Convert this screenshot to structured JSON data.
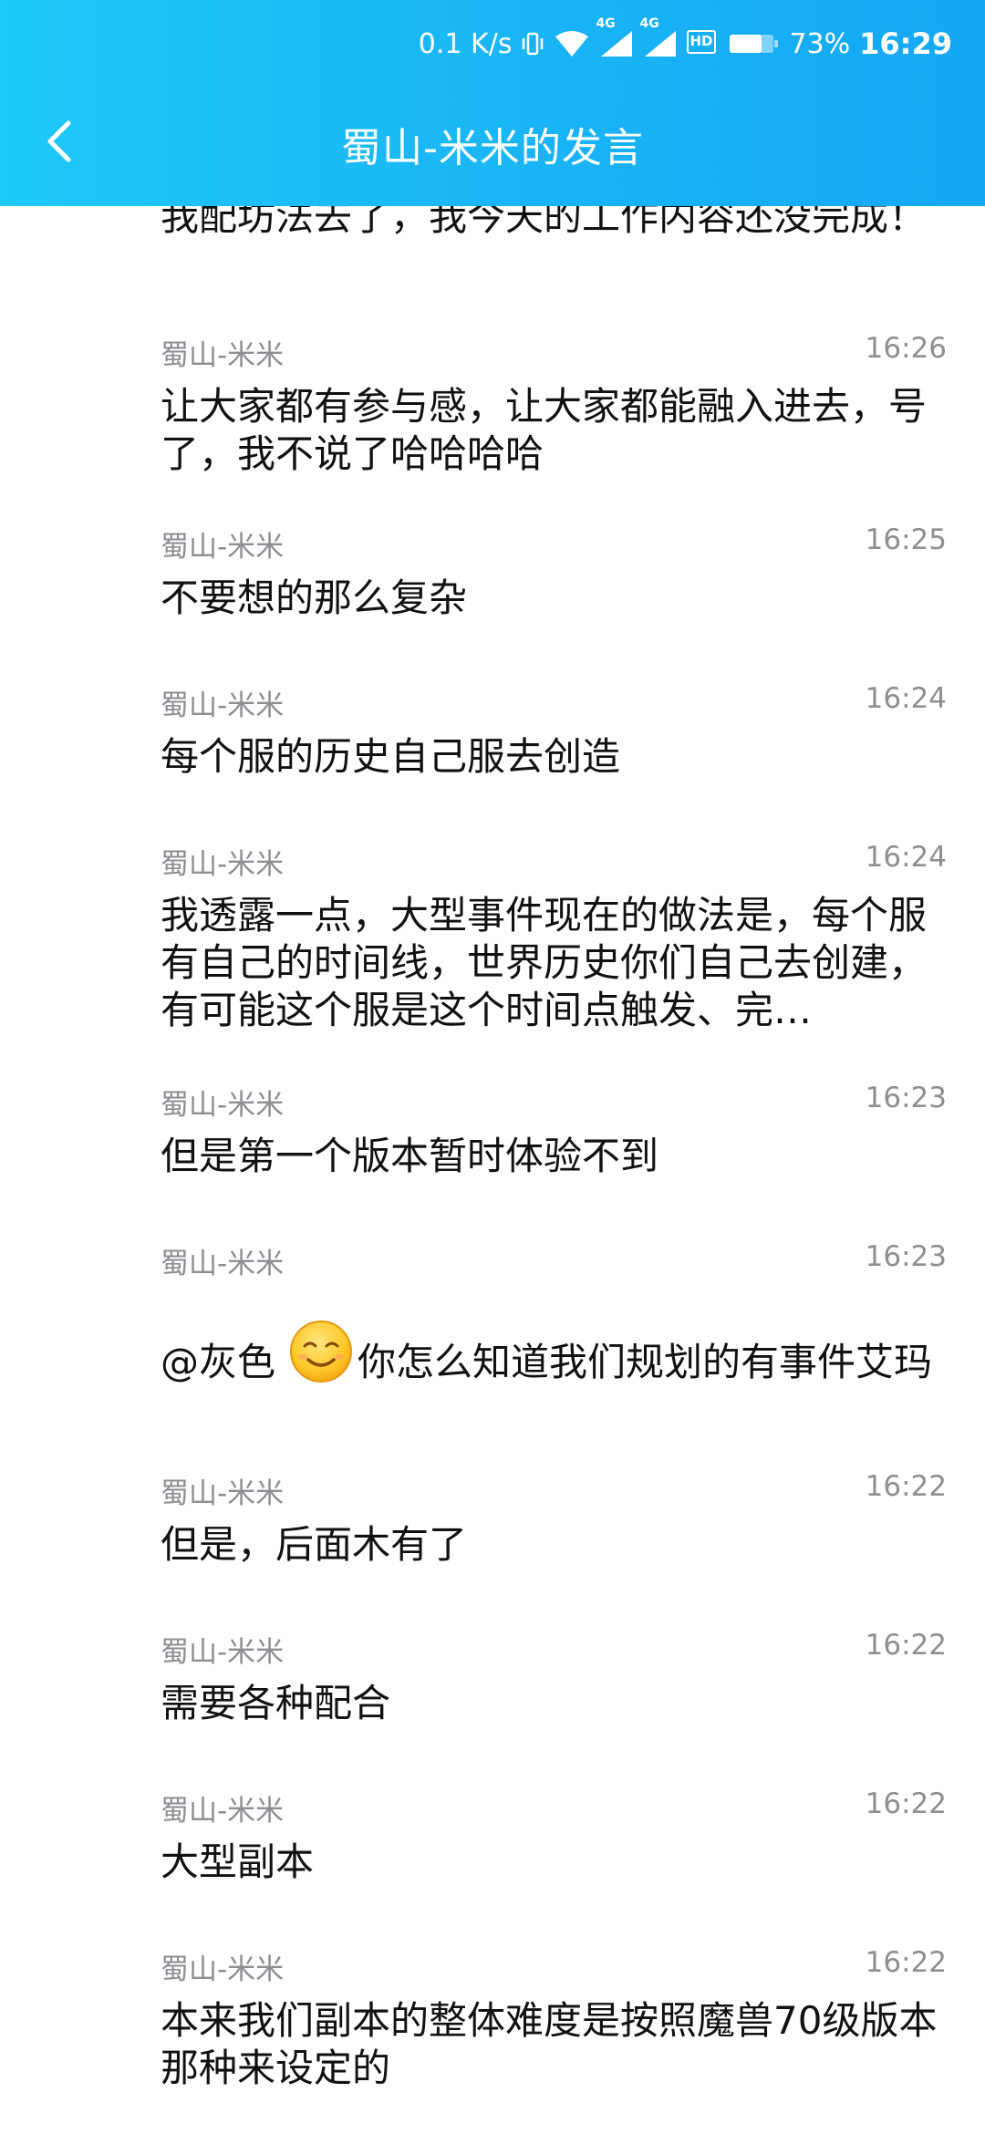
{
  "status_bar": {
    "network_speed": "0.1 K/s",
    "net_label_1": "4G",
    "net_label_2": "4G",
    "hd_label": "HD",
    "battery": "73%",
    "time": "16:29"
  },
  "header": {
    "title": "蜀山-米米的发言",
    "back_icon": "chevron-left-icon"
  },
  "messages": [
    {
      "sender": "",
      "time": "",
      "text": "我配坊法去了，我今天的工作内容还没完成！"
    },
    {
      "sender": "蜀山-米米",
      "time": "16:26",
      "text": "让大家都有参与感，让大家都能融入进去，号了，我不说了哈哈哈哈"
    },
    {
      "sender": "蜀山-米米",
      "time": "16:25",
      "text": "不要想的那么复杂"
    },
    {
      "sender": "蜀山-米米",
      "time": "16:24",
      "text": "每个服的历史自己服去创造"
    },
    {
      "sender": "蜀山-米米",
      "time": "16:24",
      "text": "我透露一点，大型事件现在的做法是，每个服有自己的时间线，世界历史你们自己去创建，有可能这个服是这个时间点触发、完…"
    },
    {
      "sender": "蜀山-米米",
      "time": "16:23",
      "text": "但是第一个版本暂时体验不到"
    },
    {
      "sender": "蜀山-米米",
      "time": "16:23",
      "mention": "@灰色",
      "emoji": "smiling-face-icon",
      "text": "你怎么知道我们规划的有事件艾玛"
    },
    {
      "sender": "蜀山-米米",
      "time": "16:22",
      "text": "但是，后面木有了"
    },
    {
      "sender": "蜀山-米米",
      "time": "16:22",
      "text": "需要各种配合"
    },
    {
      "sender": "蜀山-米米",
      "time": "16:22",
      "text": "大型副本"
    },
    {
      "sender": "蜀山-米米",
      "time": "16:22",
      "text": "本来我们副本的整体难度是按照魔兽70级版本那种来设定的"
    }
  ],
  "colors": {
    "header_gradient_start": "#1ec9f6",
    "header_gradient_end": "#15a8f3",
    "meta_text": "#8e8e93",
    "body_text": "#111111"
  }
}
